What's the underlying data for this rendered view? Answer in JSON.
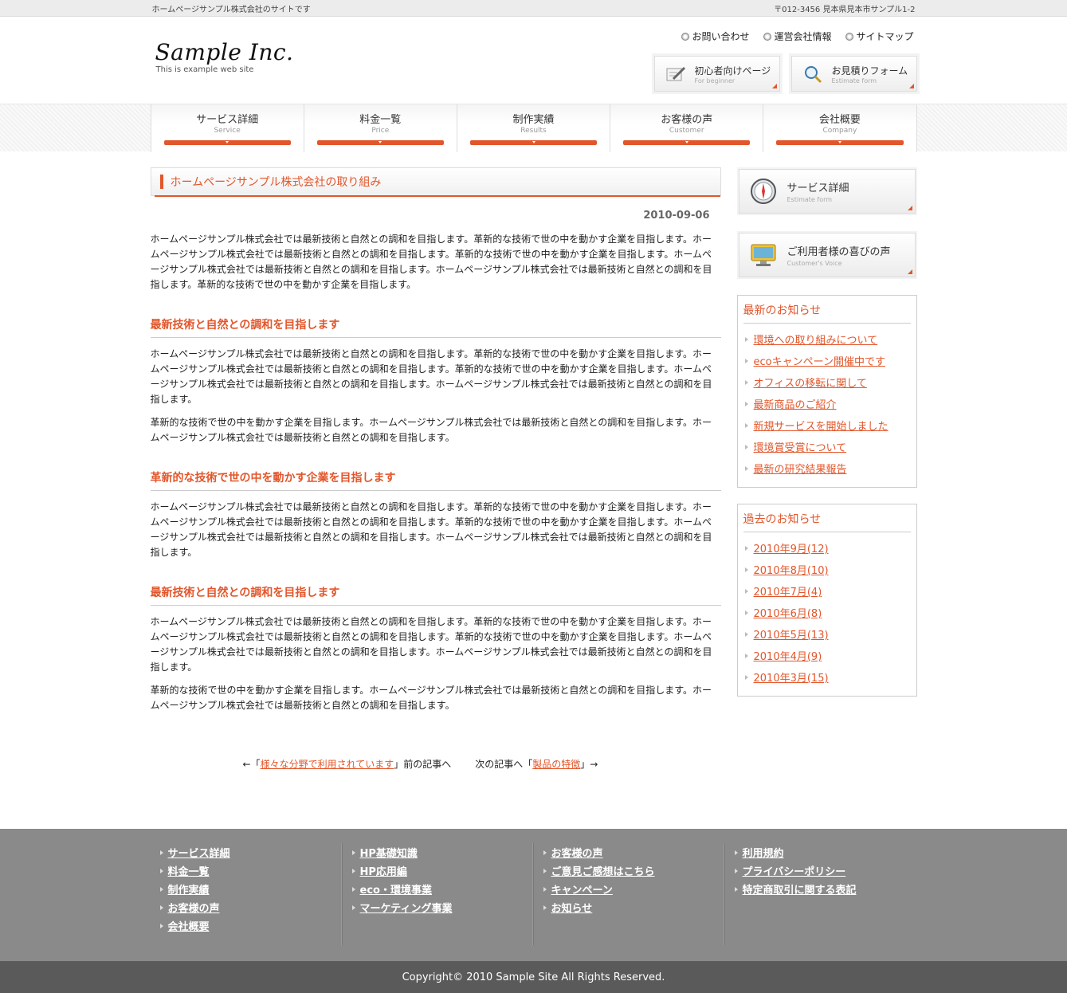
{
  "topbar": {
    "site_note": "ホームページサンプル株式会社のサイトです",
    "address": "〒012-3456 見本県見本市サンプル1-2"
  },
  "header": {
    "logo_text": "Sample Inc.",
    "logo_tagline": "This is example web site",
    "links": [
      "お問い合わせ",
      "運営会社情報",
      "サイトマップ"
    ],
    "buttons": [
      {
        "label": "初心者向けページ",
        "sub": "For beginner",
        "icon": "pencil-icon"
      },
      {
        "label": "お見積りフォーム",
        "sub": "Estimate form",
        "icon": "magnifier-icon"
      }
    ]
  },
  "nav": [
    {
      "label": "サービス詳細",
      "sub": "Service"
    },
    {
      "label": "料金一覧",
      "sub": "Price"
    },
    {
      "label": "制作実績",
      "sub": "Results"
    },
    {
      "label": "お客様の声",
      "sub": "Customer"
    },
    {
      "label": "会社概要",
      "sub": "Company"
    }
  ],
  "article": {
    "title": "ホームページサンプル株式会社の取り組み",
    "date": "2010-09-06",
    "intro": "ホームページサンプル株式会社では最新技術と自然との調和を目指します。革新的な技術で世の中を動かす企業を目指します。ホームページサンプル株式会社では最新技術と自然との調和を目指します。革新的な技術で世の中を動かす企業を目指します。ホームページサンプル株式会社では最新技術と自然との調和を目指します。ホームページサンプル株式会社では最新技術と自然との調和を目指します。革新的な技術で世の中を動かす企業を目指します。",
    "sections": [
      {
        "heading": "最新技術と自然との調和を目指します",
        "paras": [
          "ホームページサンプル株式会社では最新技術と自然との調和を目指します。革新的な技術で世の中を動かす企業を目指します。ホームページサンプル株式会社では最新技術と自然との調和を目指します。革新的な技術で世の中を動かす企業を目指します。ホームページサンプル株式会社では最新技術と自然との調和を目指します。ホームページサンプル株式会社では最新技術と自然との調和を目指します。",
          "革新的な技術で世の中を動かす企業を目指します。ホームページサンプル株式会社では最新技術と自然との調和を目指します。ホームページサンプル株式会社では最新技術と自然との調和を目指します。"
        ]
      },
      {
        "heading": "革新的な技術で世の中を動かす企業を目指します",
        "paras": [
          "ホームページサンプル株式会社では最新技術と自然との調和を目指します。革新的な技術で世の中を動かす企業を目指します。ホームページサンプル株式会社では最新技術と自然との調和を目指します。革新的な技術で世の中を動かす企業を目指します。ホームページサンプル株式会社では最新技術と自然との調和を目指します。ホームページサンプル株式会社では最新技術と自然との調和を目指します。"
        ]
      },
      {
        "heading": "最新技術と自然との調和を目指します",
        "paras": [
          "ホームページサンプル株式会社では最新技術と自然との調和を目指します。革新的な技術で世の中を動かす企業を目指します。ホームページサンプル株式会社では最新技術と自然との調和を目指します。革新的な技術で世の中を動かす企業を目指します。ホームページサンプル株式会社では最新技術と自然との調和を目指します。ホームページサンプル株式会社では最新技術と自然との調和を目指します。",
          "革新的な技術で世の中を動かす企業を目指します。ホームページサンプル株式会社では最新技術と自然との調和を目指します。ホームページサンプル株式会社では最新技術と自然との調和を目指します。"
        ]
      }
    ],
    "prev": {
      "before": "←「",
      "link": "様々な分野で利用されています",
      "after": "」前の記事へ"
    },
    "next": {
      "before": "次の記事へ「",
      "link": "製品の特徴",
      "after": "」→"
    }
  },
  "sidebar": {
    "buttons": [
      {
        "label": "サービス詳細",
        "sub": "Estimate form",
        "icon": "compass-icon"
      },
      {
        "label": "ご利用者様の喜びの声",
        "sub": "Customer's Voice",
        "icon": "monitor-icon"
      }
    ],
    "news": {
      "title": "最新のお知らせ",
      "items": [
        "環境への取り組みについて",
        "ecoキャンペーン開催中です",
        "オフィスの移転に関して",
        "最新商品のご紹介",
        "新規サービスを開始しました",
        "環境賞受賞について",
        "最新の研究結果報告"
      ]
    },
    "archive": {
      "title": "過去のお知らせ",
      "items": [
        "2010年9月(12)",
        "2010年8月(10)",
        "2010年7月(4)",
        "2010年6月(8)",
        "2010年5月(13)",
        "2010年4月(9)",
        "2010年3月(15)"
      ]
    }
  },
  "footer": {
    "columns": [
      [
        "サービス詳細",
        "料金一覧",
        "制作実績",
        "お客様の声",
        "会社概要"
      ],
      [
        "HP基礎知識",
        "HP応用編",
        "eco・環境事業",
        "マーケティング事業"
      ],
      [
        "お客様の声",
        "ご意見ご感想はこちら",
        "キャンペーン",
        "お知らせ"
      ],
      [
        "利用規約",
        "プライバシーポリシー",
        "特定商取引に関する表記"
      ]
    ],
    "copyright": "Copyright© 2010 Sample Site All Rights Reserved."
  },
  "colors": {
    "accent": "#e2562b",
    "footer_bg": "#8a8a8a",
    "copyright_bg": "#5a5a5a"
  }
}
